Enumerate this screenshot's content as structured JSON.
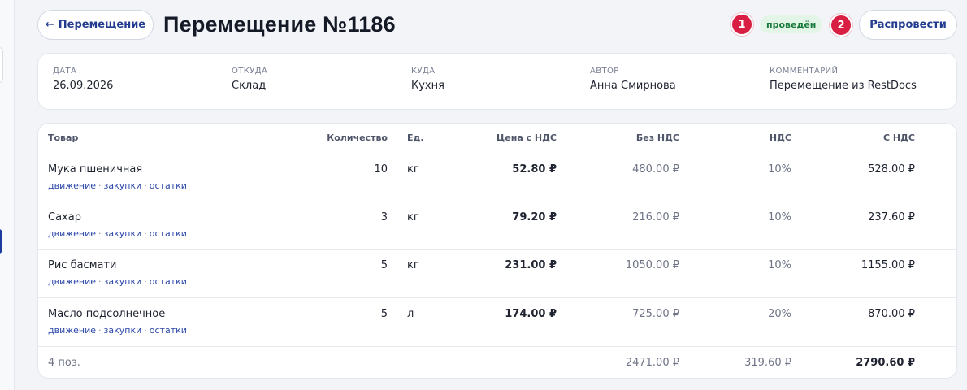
{
  "header": {
    "back_label": "Перемещение",
    "title": "Перемещение №1186",
    "status": "проведён",
    "post_label": "Распровести",
    "markers": [
      "1",
      "2"
    ]
  },
  "info": {
    "date": {
      "label": "ДАТА",
      "value": "26.09.2026"
    },
    "from": {
      "label": "ОТКУДА",
      "value": "Склад"
    },
    "to": {
      "label": "КУДА",
      "value": "Кухня"
    },
    "author": {
      "label": "АВТОР",
      "value": "Анна Смирнова"
    },
    "comment": {
      "label": "КОММЕНТАРИЙ",
      "value": "Перемещение из RestDocs"
    }
  },
  "table": {
    "columns": {
      "item": "Товар",
      "qty": "Количество",
      "unit": "Ед.",
      "price": "Цена с НДС",
      "net": "Без НДС",
      "vat": "НДС",
      "gross": "С НДС"
    },
    "link_labels": {
      "movement": "движение",
      "purchases": "закупки",
      "stock": "остатки"
    },
    "rows": [
      {
        "name": "Мука пшеничная",
        "qty": "10",
        "unit": "кг",
        "price": "52.80 ₽",
        "net": "480.00 ₽",
        "vat": "10%",
        "gross": "528.00 ₽"
      },
      {
        "name": "Сахар",
        "qty": "3",
        "unit": "кг",
        "price": "79.20 ₽",
        "net": "216.00 ₽",
        "vat": "10%",
        "gross": "237.60 ₽"
      },
      {
        "name": "Рис басмати",
        "qty": "5",
        "unit": "кг",
        "price": "231.00 ₽",
        "net": "1050.00 ₽",
        "vat": "10%",
        "gross": "1155.00 ₽"
      },
      {
        "name": "Масло подсолнечное",
        "qty": "5",
        "unit": "л",
        "price": "174.00 ₽",
        "net": "725.00 ₽",
        "vat": "20%",
        "gross": "870.00 ₽"
      }
    ],
    "footer": {
      "count": "4 поз.",
      "net_total": "2471.00 ₽",
      "vat_total": "319.60 ₽",
      "gross_total": "2790.60 ₽"
    }
  }
}
